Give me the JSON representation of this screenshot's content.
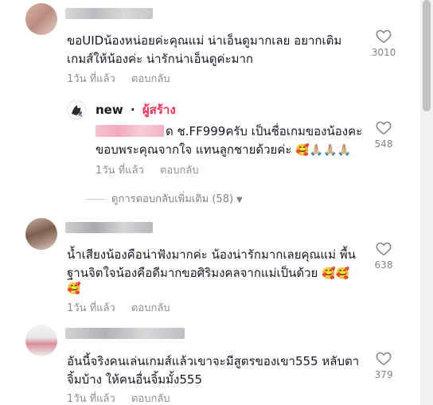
{
  "comments": [
    {
      "text_line1": "ขอUIDน้องหน่อยค่ะคุณแม่ น่าเอ็นดูมากเลย อยากเติม",
      "text_line2": "เกมส์ให้น้องค่ะ น่ารักน่าเอ็นดูค่ะมาก",
      "time": "1วัน ที่แล้ว",
      "reply_label": "ตอบกลับ",
      "likes": "3010"
    },
    {
      "text_line1": "น้ำเสียงน้องคือน่าฟังมากค่ะ น้องน่ารักมากเลยคุณแม่ พื้น",
      "text_line2": "ฐานจิตใจน้องคือดีมากขอศิริมงคลจากแม่เป็นด้วย",
      "emoji_line2": "🥰🥰",
      "emoji_line3": "🥰",
      "time": "1วัน ที่แล้ว",
      "reply_label": "ตอบกลับ",
      "likes": "638"
    },
    {
      "text_line1": "อันนี้จริงคนเล่นเกมส์แล้วเขาจะมีสูตรของเขา555 หลับตา",
      "text_line2": "จิ้มบ้าง ให้คนอื่นจิ้มมั้ง555",
      "time": "1วัน ที่แล้ว",
      "reply_label": "ตอบกลับ",
      "likes": "379"
    }
  ],
  "creator_reply": {
    "username": "new",
    "separator": "·",
    "badge": "ผู้สร้าง",
    "text_line1": "ด ช.FF999ครับ เป็นชื่อเกมของน้องคะ",
    "text_line2": "ขอบพระคุณจากใจ แทนลูกชายด้วยค่ะ",
    "emoji_line2": "🥰🙏🏼🙏🏼🙏🏼",
    "time": "1วัน ที่แล้ว",
    "reply_label": "ตอบกลับ",
    "likes": "548"
  },
  "more_replies_label": "ดูการตอบกลับเพิ่มเติม (58)",
  "colors": {
    "creator_badge": "#fe2c55",
    "heart_outline": "#8a8b91",
    "muted_text": "#8a8b91"
  }
}
